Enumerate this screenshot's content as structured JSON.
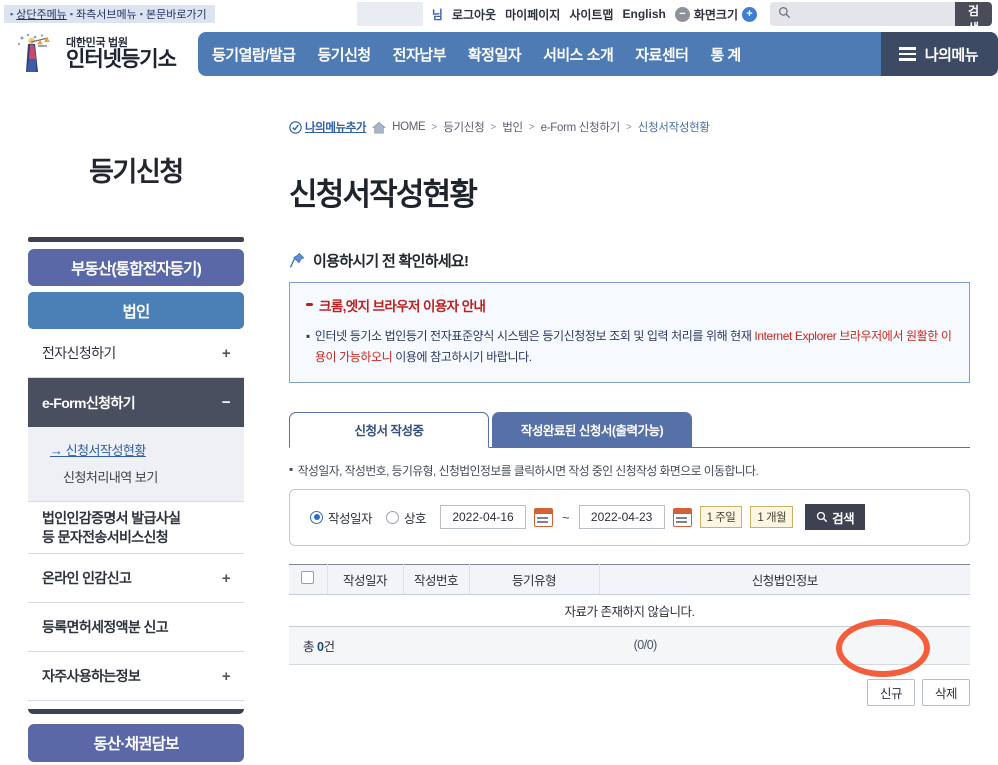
{
  "topbar": {
    "skip_links": [
      "상단주메뉴",
      "좌측서브메뉴",
      "본문바로가기"
    ],
    "user_suffix": "님",
    "links": [
      "로그아웃",
      "마이페이지",
      "사이트맵",
      "English"
    ],
    "zoom_label": "화면크기",
    "zoom_minus": "−",
    "zoom_plus": "+",
    "search_placeholder": "",
    "search_value": "",
    "search_button": "검색"
  },
  "header": {
    "logo_line1": "대한민국 법원",
    "logo_line2": "인터넷등기소",
    "nav": [
      "등기열람/발급",
      "등기신청",
      "전자납부",
      "확정일자",
      "서비스 소개",
      "자료센터",
      "통 계"
    ],
    "mymenu": "나의메뉴"
  },
  "breadcrumb": {
    "add_label": "나의메뉴추가",
    "items": [
      "HOME",
      "등기신청",
      "법인",
      "e-Form 신청하기",
      "신청서작성현황"
    ]
  },
  "sidebar": {
    "title": "등기신청",
    "realestate": "부동산(통합전자등기)",
    "corp": "법인",
    "rows": [
      {
        "label": "전자신청하기",
        "pm": "+"
      },
      {
        "label": "e-Form신청하기",
        "pm": "−"
      }
    ],
    "sub_items": [
      {
        "label": "신청서작성현황",
        "current": true
      },
      {
        "label": "신청처리내역 보기",
        "current": false
      }
    ],
    "rows2": [
      {
        "label_l1": "법인인감증명서 발급사실",
        "label_l2": "등 문자전송서비스신청",
        "pm": ""
      },
      {
        "label_l1": "온라인 인감신고",
        "label_l2": "",
        "pm": "+"
      },
      {
        "label_l1": "등록면허세정액분 신고",
        "label_l2": "",
        "pm": ""
      },
      {
        "label_l1": "자주사용하는정보",
        "label_l2": "",
        "pm": "+"
      }
    ],
    "movable": "동산·채권담보"
  },
  "main": {
    "page_title": "신청서작성현황",
    "notice_head": "이용하시기 전 확인하세요!",
    "notice_title": "크롬,엣지 브라우저 이용자 안내",
    "notice_body_pre": "인터넷 등기소 법인등기 전자표준양식 시스템은 등기신청정보 조회 및 입력 처리를 위해 현재 ",
    "notice_body_em": "Internet Explorer 브라우저에서 원활한 이용이 가능하오니",
    "notice_body_post": " 이용에 참고하시기 바랍니다.",
    "tabs": [
      {
        "label": "신청서 작성중",
        "active": true
      },
      {
        "label": "작성완료된 신청서(출력가능)",
        "active": false
      }
    ],
    "hint": "작성일자, 작성번호, 등기유형, 신청법인정보를 클릭하시면 작성 중인 신청작성 화면으로 이동합니다.",
    "filter": {
      "radio_date": "작성일자",
      "radio_name": "상호",
      "date_from": "2022-04-16",
      "date_to": "2022-04-23",
      "range_week": "1 주일",
      "range_month": "1 개월",
      "search_button": "검색"
    },
    "table": {
      "headers": [
        "작성일자",
        "작성번호",
        "등기유형",
        "신청법인정보"
      ],
      "rows": [],
      "empty_message": "자료가 존재하지 않습니다."
    },
    "total_prefix": "총 ",
    "total_count": "0",
    "total_suffix": "건",
    "pager": "(0/0)",
    "buttons": [
      {
        "label": "신규",
        "highlighted": true
      },
      {
        "label": "삭제",
        "highlighted": false
      }
    ]
  },
  "colors": {
    "nav_blue": "#4e7bb4",
    "mymenu_navy": "#3d4a63",
    "sidebar_purple": "#5a68a8",
    "sidebar_steel": "#4a80b5",
    "notice_red": "#c01f1f",
    "annotation_orange": "#f4502c",
    "tab_blue": "#5671a8"
  }
}
